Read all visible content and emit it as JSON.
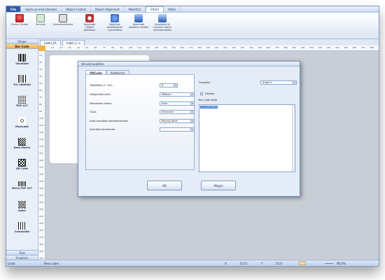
{
  "menubar": {
    "tabs": [
      "File",
      "Ugrás az első rekordra",
      "Object Control",
      "Object Alignment",
      "Nézet(V)",
      "Eltűnt",
      "Other"
    ]
  },
  "ribbon": {
    "buttons": [
      {
        "label": "Printer Control",
        "color": "#cc2a2a"
      },
      {
        "label": "Terminál",
        "color": "#3a8a3a"
      },
      {
        "label": "Szerszámkészlet",
        "color": "#5a5a5a"
      },
      {
        "label": "Nyomtató\nidőzítő\nbeállítása",
        "color": "#b03030"
      },
      {
        "label": "Objektum\nbeállításának\nnyomtatása",
        "color": "#2a6ab0"
      },
      {
        "label": "Nyomtató\nobjektum törlése",
        "color": "#2a6ab0"
      },
      {
        "label": "Nyomtató és\nCoLabel rekord\nszinkronizálása",
        "color": "#2a6ab0"
      }
    ]
  },
  "doc_tabs": [
    "Label_01",
    "Label_1 ⊙"
  ],
  "sidebar": {
    "head": "Shape",
    "active": "Bar Code",
    "items": [
      "Vonalkód",
      "G1/ adatkód",
      "PDF 417",
      "Maxicode",
      "Data Matrix",
      "QR Code",
      "Micro PDF 417",
      "Aztec",
      "Composite"
    ],
    "foot_text": "Text",
    "foot_graphics": "Graphics"
  },
  "ruler": {
    "h": [
      "10",
      "20",
      "30",
      "40",
      "50",
      "60",
      "70",
      "80",
      "90",
      "100",
      "110",
      "120",
      "130",
      "140",
      "150",
      "160",
      "170",
      "180",
      "190",
      "200",
      "210",
      "220",
      "230",
      "240",
      "250",
      "260",
      "270",
      "280",
      "290",
      "300",
      "310",
      "320",
      "330",
      "340",
      "350",
      "360",
      "370",
      "380",
      "390"
    ],
    "v": [
      "10",
      "20",
      "30",
      "40",
      "50",
      "60",
      "70",
      "80",
      "90",
      "100",
      "110",
      "120",
      "130",
      "140",
      "150",
      "160",
      "170",
      "180",
      "190",
      "200",
      "210",
      "220",
      "230",
      "240",
      "250",
      "260",
      "270",
      "280",
      "290",
      "300"
    ]
  },
  "dialog": {
    "title": "QR-kód beállítás",
    "tabs": [
      "QRCode",
      "Adatforrás"
    ],
    "fields": [
      {
        "label": "Töltöttöbe (1~40):",
        "value": "8"
      },
      {
        "label": "Hibajavítás szint:",
        "value": "Medium"
      },
      {
        "label": "Maszkolási faktor:",
        "value": "Auto"
      },
      {
        "label": "Típus",
        "value": "Enhanced"
      },
      {
        "label": "Adat-szerződő karakterkészlet:",
        "value": "Moving Mode"
      },
      {
        "label": "Speciális karakterek",
        "value": ""
      }
    ],
    "rotation_label": "Forgatás:",
    "rotation_value": "Angle 0",
    "lock_label": "Zárolás",
    "barcode_data_label": "Bar Code Data",
    "barcode_data_value": "1234567890",
    "ok": "OK",
    "cancel": "Mégse"
  },
  "status": {
    "left": "Lezár",
    "label": "New Label",
    "x_label": "X",
    "x_value": "113.5",
    "y_label": "Y",
    "y_value": "25.0",
    "zoom": "90.0%"
  }
}
